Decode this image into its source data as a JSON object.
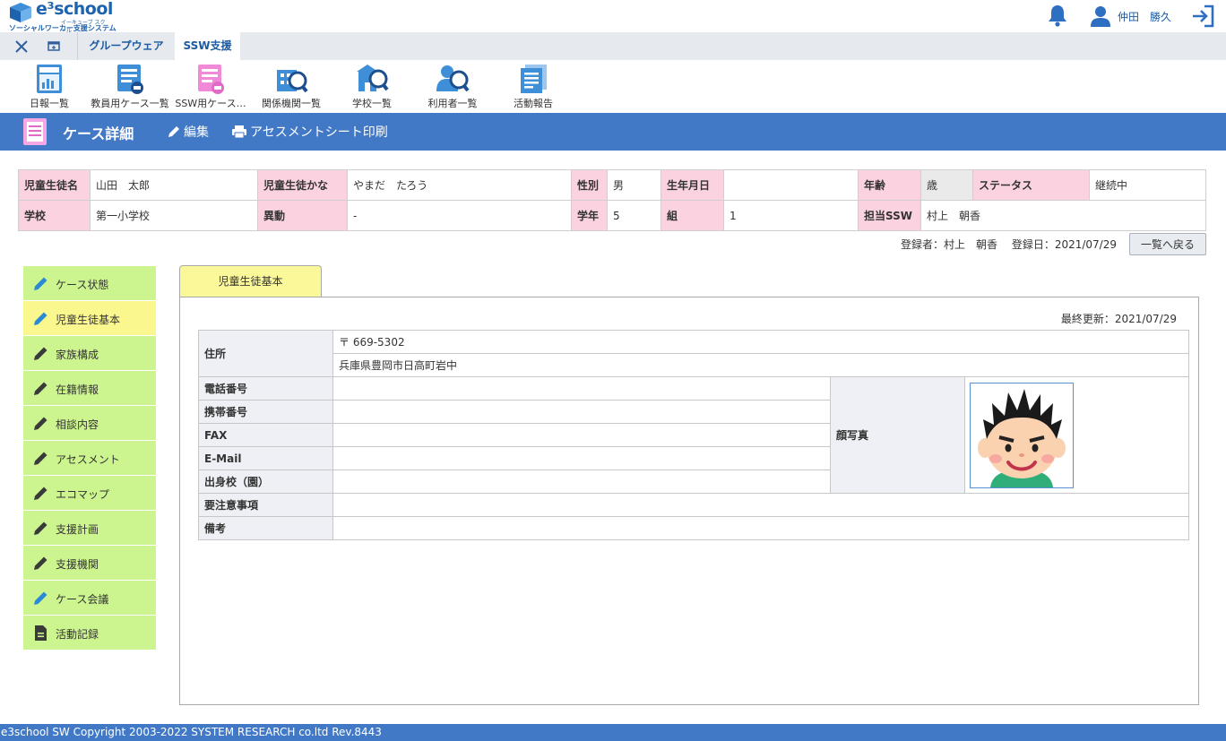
{
  "app": {
    "logo_word": "e³school",
    "logo_kana": "イーキューブ スクール",
    "logo_sub": "ソーシャルワーカー支援システム"
  },
  "header": {
    "user_name": "仲田　勝久"
  },
  "tabs": {
    "groupware": "グループウェア",
    "ssw": "SSW支援"
  },
  "toolbar": [
    {
      "label": "日報一覧",
      "icon": "daily-report-icon"
    },
    {
      "label": "教員用ケース一覧",
      "icon": "teacher-case-icon"
    },
    {
      "label": "SSW用ケース…",
      "icon": "ssw-case-icon"
    },
    {
      "label": "関係機関一覧",
      "icon": "institution-search-icon"
    },
    {
      "label": "学校一覧",
      "icon": "school-search-icon"
    },
    {
      "label": "利用者一覧",
      "icon": "user-search-icon"
    },
    {
      "label": "活動報告",
      "icon": "activity-report-icon"
    }
  ],
  "titlebar": {
    "title": "ケース詳細",
    "edit": "編集",
    "print": "アセスメントシート印刷"
  },
  "info": {
    "name_label": "児童生徒名",
    "name": "山田　太郎",
    "kana_label": "児童生徒かな",
    "kana": "やまだ　たろう",
    "gender_label": "性別",
    "gender": "男",
    "birth_label": "生年月日",
    "birth": "",
    "age_label": "年齢",
    "age": "歳",
    "status_label": "ステータス",
    "status": "継続中",
    "school_label": "学校",
    "school": "第一小学校",
    "transfer_label": "異動",
    "transfer": "-",
    "grade_label": "学年",
    "grade": "5",
    "class_label": "組",
    "class": "1",
    "ssw_label": "担当SSW",
    "ssw": "村上　朝香"
  },
  "registration": {
    "text": "登録者：村上　朝香　 登録日：2021/07/29",
    "back_button": "一覧へ戻る"
  },
  "side_menu": [
    {
      "label": "ケース状態",
      "icon": "pencil-blue-icon",
      "active": false
    },
    {
      "label": "児童生徒基本",
      "icon": "pencil-blue-icon",
      "active": true
    },
    {
      "label": "家族構成",
      "icon": "pencil-dark-icon",
      "active": false
    },
    {
      "label": "在籍情報",
      "icon": "pencil-dark-icon",
      "active": false
    },
    {
      "label": "相談内容",
      "icon": "pencil-dark-icon",
      "active": false
    },
    {
      "label": "アセスメント",
      "icon": "pencil-dark-icon",
      "active": false
    },
    {
      "label": "エコマップ",
      "icon": "pencil-dark-icon",
      "active": false
    },
    {
      "label": "支援計画",
      "icon": "pencil-dark-icon",
      "active": false
    },
    {
      "label": "支援機関",
      "icon": "pencil-dark-icon",
      "active": false
    },
    {
      "label": "ケース会議",
      "icon": "pencil-blue-icon",
      "active": false
    },
    {
      "label": "活動記録",
      "icon": "document-icon",
      "active": false
    }
  ],
  "content": {
    "tab_label": "児童生徒基本",
    "last_updated": "最終更新：2021/07/29",
    "address_label": "住所",
    "postal": "〒 669-5302",
    "address": "兵庫県豊岡市日高町岩中",
    "phone_label": "電話番号",
    "phone": "",
    "mobile_label": "携帯番号",
    "mobile": "",
    "fax_label": "FAX",
    "fax": "",
    "email_label": "E-Mail",
    "email": "",
    "origin_school_label": "出身校（園）",
    "origin_school": "",
    "photo_label": "顔写真",
    "caution_label": "要注意事項",
    "caution": "",
    "notes_label": "備考",
    "notes": ""
  },
  "footer": {
    "text": "e3school SW Copyright 2003-2022 SYSTEM RESEARCH co.ltd Rev.8443"
  },
  "colors": {
    "brand": "#1d63ad",
    "titlebar": "#4279c6",
    "info_label": "#fbd3e0",
    "side_item": "#cdf58f",
    "side_active": "#fbf78f"
  }
}
